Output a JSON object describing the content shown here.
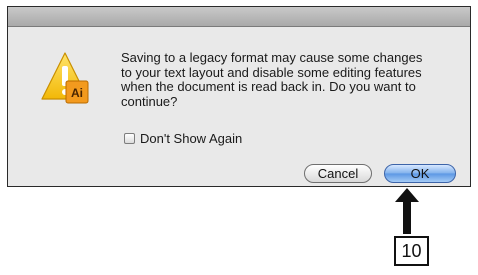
{
  "dialog": {
    "app_icon": "illustrator-icon",
    "warning_icon": "warning-icon",
    "app_badge_text": "Ai",
    "message_lines": [
      "Saving to a legacy format may cause some changes",
      "to your text layout and disable some editing features",
      "when the document is read back in. Do you want to",
      "continue?"
    ],
    "checkbox": {
      "label": "Don't Show Again",
      "checked": false
    },
    "buttons": {
      "cancel": "Cancel",
      "ok": "OK"
    }
  },
  "callout": {
    "number": "10"
  },
  "colors": {
    "warning_yellow": "#f5c518",
    "ai_badge": "#f39a1e",
    "ok_button_blue": "#6fa6ea"
  }
}
